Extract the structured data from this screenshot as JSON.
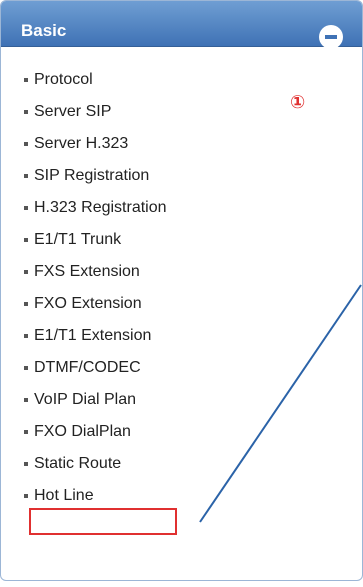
{
  "panel": {
    "title": "Basic",
    "collapse_icon": "minus-circle-icon",
    "accent_color": "#3f72b5"
  },
  "menu": {
    "items": [
      {
        "label": "Protocol"
      },
      {
        "label": "Server SIP"
      },
      {
        "label": "Server H.323"
      },
      {
        "label": "SIP Registration"
      },
      {
        "label": "H.323 Registration"
      },
      {
        "label": "E1/T1 Trunk"
      },
      {
        "label": "FXS Extension"
      },
      {
        "label": "FXO Extension"
      },
      {
        "label": "E1/T1 Extension"
      },
      {
        "label": "DTMF/CODEC"
      },
      {
        "label": "VoIP Dial Plan"
      },
      {
        "label": "FXO DialPlan"
      },
      {
        "label": "Static Route"
      },
      {
        "label": "Hot Line"
      }
    ]
  },
  "annotation": {
    "marker": "①",
    "highlight_color": "#e03030",
    "pointer_color": "#2b63a8"
  }
}
